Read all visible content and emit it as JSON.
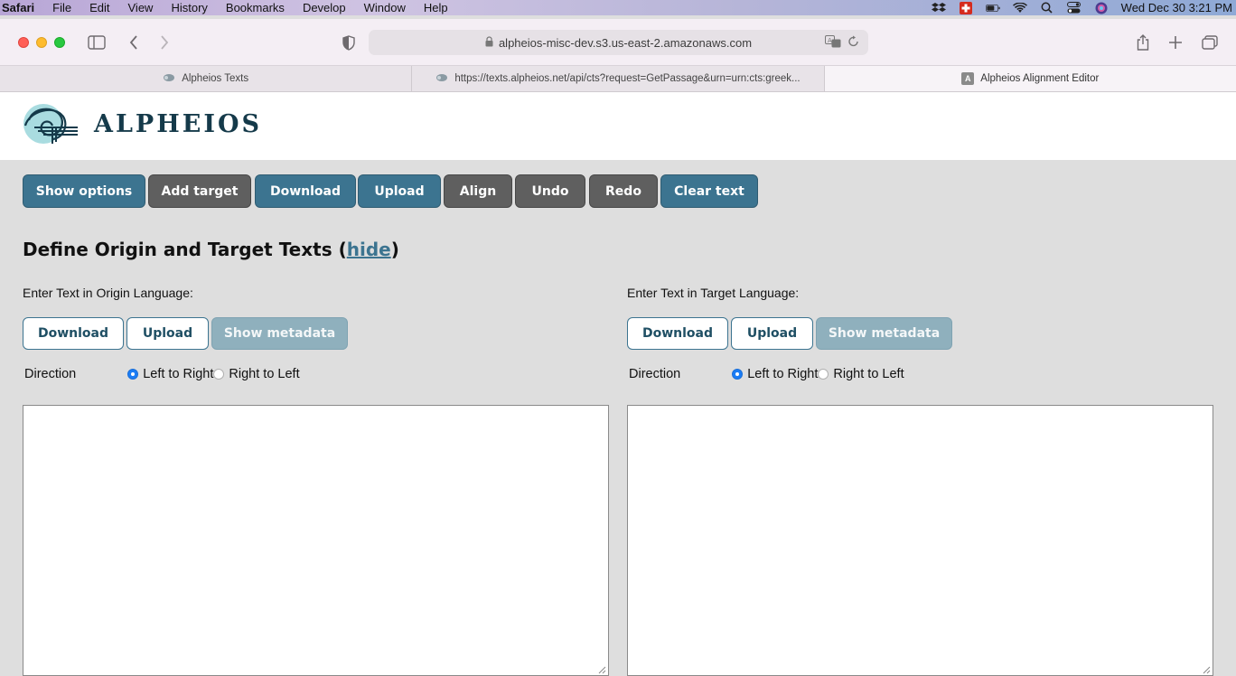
{
  "menubar": {
    "app": "Safari",
    "items": [
      "File",
      "Edit",
      "View",
      "History",
      "Bookmarks",
      "Develop",
      "Window",
      "Help"
    ],
    "clock": "Wed Dec 30  3:21 PM",
    "status_icons": [
      "dropbox-icon",
      "swiss-cross-icon",
      "battery-icon",
      "wifi-icon",
      "spotlight-search-icon",
      "control-center-icon",
      "siri-icon"
    ]
  },
  "browser": {
    "address": "alpheios-misc-dev.s3.us-east-2.amazonaws.com",
    "tabs": [
      {
        "label": "Alpheios Texts",
        "favicon": "alpheios-favicon"
      },
      {
        "label": "https://texts.alpheios.net/api/cts?request=GetPassage&urn=urn:cts:greek...",
        "favicon": "alpheios-favicon"
      },
      {
        "label": "Alpheios Alignment Editor",
        "favicon": "A",
        "active": true
      }
    ]
  },
  "site": {
    "logo_text": "ALPHEIOS"
  },
  "actions": {
    "show_options": "Show options",
    "add_target": "Add target",
    "download": "Download",
    "upload": "Upload",
    "align": "Align",
    "undo": "Undo",
    "redo": "Redo",
    "clear_text": "Clear text"
  },
  "section": {
    "title": "Define Origin and Target Texts (",
    "hide_link": "hide",
    "title_end": ")"
  },
  "origin": {
    "label": "Enter Text in Origin Language:",
    "download": "Download",
    "upload": "Upload",
    "show_metadata": "Show metadata",
    "direction_label": "Direction",
    "ltr": "Left to Right",
    "rtl": "Right to Left",
    "selected": "ltr",
    "text": ""
  },
  "target": {
    "label": "Enter Text in Target Language:",
    "download": "Download",
    "upload": "Upload",
    "show_metadata": "Show metadata",
    "direction_label": "Direction",
    "ltr": "Left to Right",
    "rtl": "Right to Left",
    "selected": "ltr",
    "text": ""
  },
  "colors": {
    "primary": "#3c7490",
    "secondary": "#5f5f5f",
    "muted": "#8fb0bd",
    "logo": "#153a4a",
    "background": "#dedede"
  }
}
